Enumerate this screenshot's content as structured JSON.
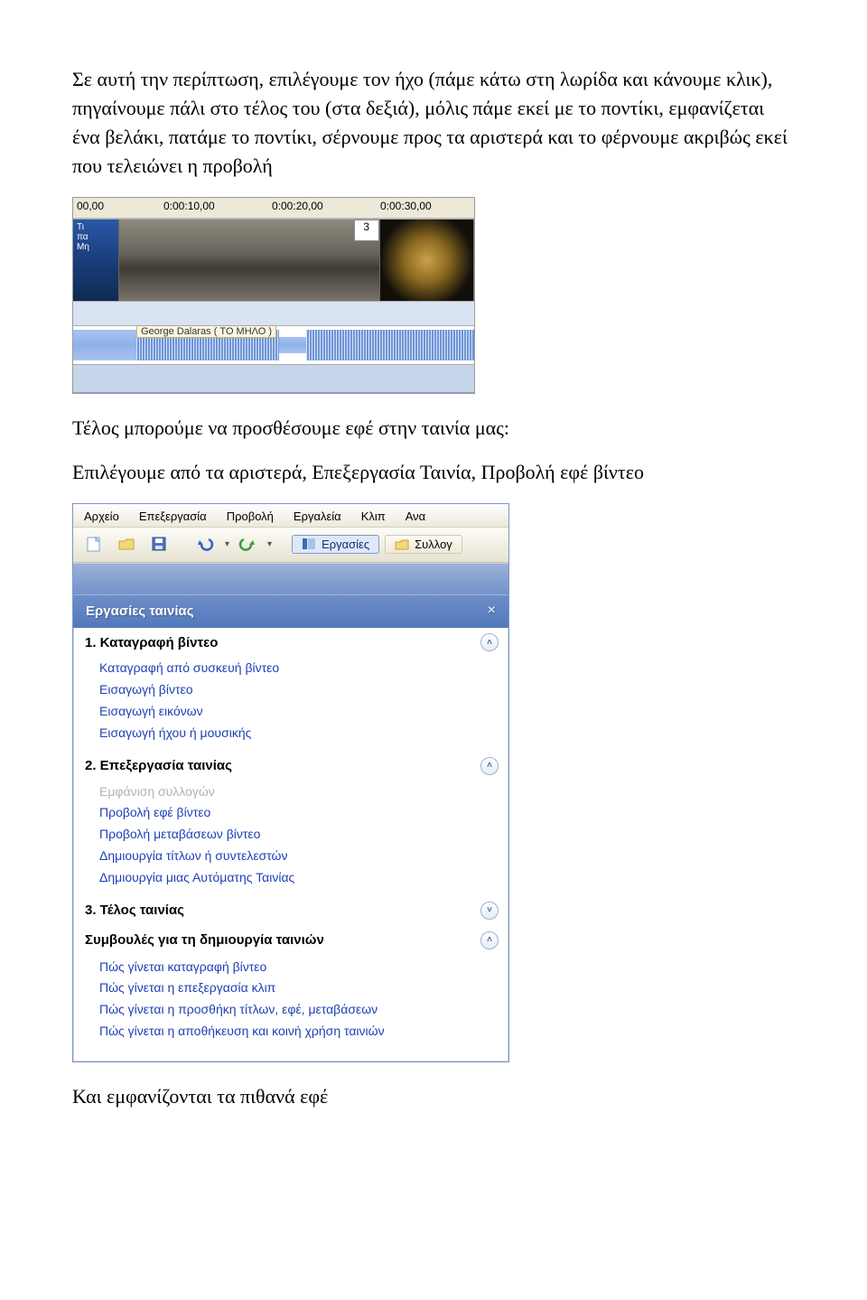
{
  "para1": "Σε αυτή την περίπτωση, επιλέγουμε τον ήχο (πάμε κάτω στη λωρίδα και κάνουμε κλικ), πηγαίνουμε πάλι στο τέλος του (στα δεξιά), μόλις πάμε εκεί με το ποντίκι, εμφανίζεται ένα βελάκι, πατάμε το ποντίκι, σέρνουμε προς τα αριστερά και το φέρνουμε ακριβώς εκεί που τελειώνει η προβολή",
  "para2": "Τέλος μπορούμε να προσθέσουμε εφέ στην ταινία μας:",
  "para3": "Επιλέγουμε από τα αριστερά, Επεξεργασία Ταινία, Προβολή εφέ βίντεο",
  "para4": "Και εμφανίζονται τα πιθανά εφέ",
  "timeline": {
    "ticks": [
      "00,00",
      "0:00:10,00",
      "0:00:20,00",
      "0:00:30,00"
    ],
    "clipA": {
      "line1": "Τι",
      "line2": "πα",
      "line3": "Μη"
    },
    "clipB_overlay": "3",
    "audio_label": "George Dalaras ( ΤΟ ΜΗΛΟ )"
  },
  "mm": {
    "menubar": [
      "Αρχείο",
      "Επεξεργασία",
      "Προβολή",
      "Εργαλεία",
      "Κλιπ",
      "Ανα"
    ],
    "tasks_btn": "Εργασίες",
    "collections_btn": "Συλλογ",
    "pane_title": "Εργασίες ταινίας",
    "close_x": "×",
    "section1": {
      "title": "1. Καταγραφή βίντεο",
      "items": [
        "Καταγραφή από συσκευή βίντεο",
        "Εισαγωγή βίντεο",
        "Εισαγωγή εικόνων",
        "Εισαγωγή ήχου ή μουσικής"
      ]
    },
    "section2": {
      "title": "2. Επεξεργασία ταινίας",
      "items": [
        {
          "label": "Εμφάνιση συλλογών",
          "disabled": true
        },
        {
          "label": "Προβολή εφέ βίντεο",
          "disabled": false
        },
        {
          "label": "Προβολή μεταβάσεων βίντεο",
          "disabled": false
        },
        {
          "label": "Δημιουργία τίτλων ή συντελεστών",
          "disabled": false
        },
        {
          "label": "Δημιουργία μιας Αυτόματης Ταινίας",
          "disabled": false
        }
      ]
    },
    "section3": {
      "title": "3. Τέλος ταινίας"
    },
    "tips": {
      "title": "Συμβουλές για τη δημιουργία ταινιών",
      "items": [
        "Πώς γίνεται καταγραφή βίντεο",
        "Πώς γίνεται η επεξεργασία κλιπ",
        "Πώς γίνεται η προσθήκη τίτλων, εφέ, μεταβάσεων",
        "Πώς γίνεται η αποθήκευση και κοινή χρήση ταινιών"
      ]
    }
  }
}
